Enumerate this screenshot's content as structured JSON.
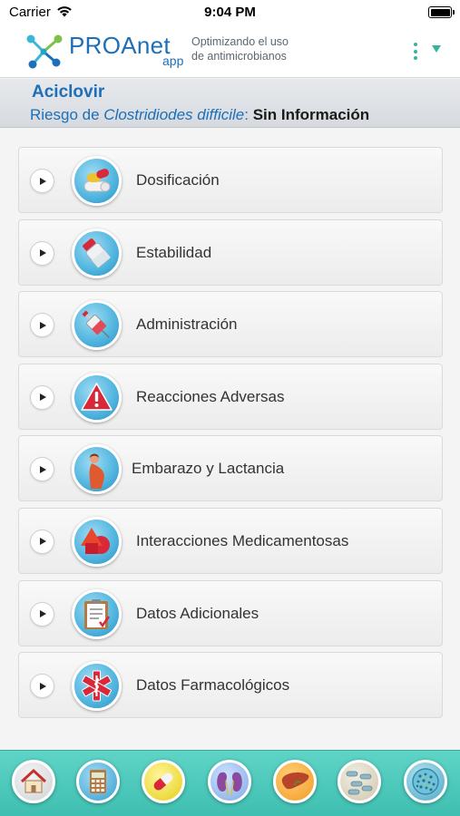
{
  "status_bar": {
    "carrier": "Carrier",
    "time": "9:04 PM"
  },
  "header": {
    "brand": "PROAnet",
    "brand_suffix": "app",
    "tagline_line1": "Optimizando el uso",
    "tagline_line2": "de antimicrobianos",
    "accent_color": "#36b49c",
    "brand_color": "#1c6fb8"
  },
  "drug": {
    "name": "Aciclovir",
    "risk_prefix": "Riesgo de",
    "risk_organism": "Clostridiodes difficile",
    "risk_separator": ":",
    "risk_value": "Sin Información"
  },
  "sections": [
    {
      "label": "Dosificación",
      "icon": "pills-icon"
    },
    {
      "label": "Estabilidad",
      "icon": "vial-icon"
    },
    {
      "label": "Administración",
      "icon": "syringe-icon"
    },
    {
      "label": "Reacciones Adversas",
      "icon": "warning-icon"
    },
    {
      "label": "Embarazo y Lactancia",
      "icon": "pregnancy-icon"
    },
    {
      "label": "Interacciones Medicamentosas",
      "icon": "interaction-shapes-icon"
    },
    {
      "label": "Datos Adicionales",
      "icon": "clipboard-icon"
    },
    {
      "label": "Datos Farmacológicos",
      "icon": "medical-star-icon"
    }
  ],
  "tabbar": {
    "items": [
      {
        "icon": "home-icon"
      },
      {
        "icon": "calculator-icon"
      },
      {
        "icon": "capsule-icon"
      },
      {
        "icon": "kidneys-icon"
      },
      {
        "icon": "liver-icon"
      },
      {
        "icon": "bacteria-icon"
      },
      {
        "icon": "microbe-culture-icon"
      }
    ]
  }
}
